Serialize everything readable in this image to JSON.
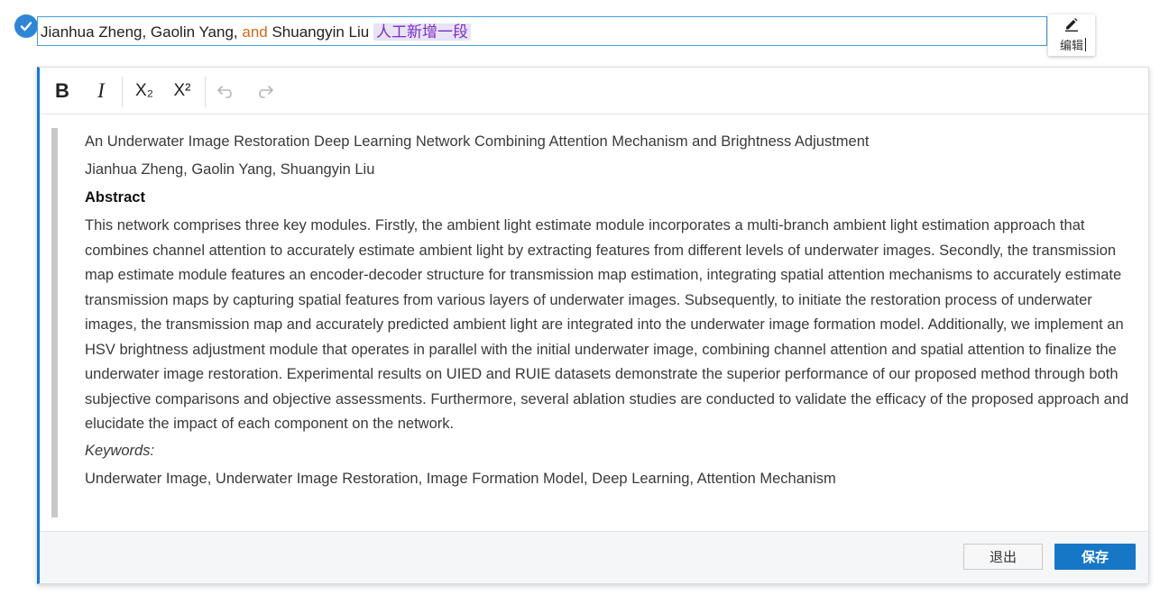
{
  "title_line": {
    "segments": {
      "part1": "Jianhua Zheng, Gaolin Yang, ",
      "and": "and",
      "part2": " Shuangyin Liu ",
      "added": "人工新增一段"
    },
    "check_icon": "check-icon"
  },
  "edit_button": {
    "label": "编辑",
    "icon": "pencil-icon"
  },
  "toolbar": {
    "bold_label": "B",
    "italic_label": "I",
    "subscript_label": "X₂",
    "superscript_label": "X²",
    "undo_icon": "undo-icon",
    "redo_icon": "redo-icon"
  },
  "document": {
    "title": "An Underwater Image Restoration Deep Learning Network Combining Attention Mechanism and Brightness Adjustment",
    "authors": "Jianhua Zheng, Gaolin Yang, Shuangyin Liu",
    "abstract_heading": "Abstract",
    "abstract_text": "This network comprises three key modules. Firstly, the ambient light estimate module incorporates a multi-branch ambient light estimation approach that combines channel attention to accurately estimate ambient light by extracting features from different levels of underwater images. Secondly, the transmission map estimate module features an encoder-decoder structure for transmission map estimation, integrating spatial attention mechanisms to accurately estimate transmission maps by capturing spatial features from various layers of underwater images. Subsequently, to initiate the restoration process of underwater images, the transmission map and accurately predicted ambient light are integrated into the underwater image formation model. Additionally, we implement an HSV brightness adjustment module that operates in parallel with the initial underwater image, combining channel attention and spatial attention to finalize the underwater image restoration. Experimental results on UIED and RUIE datasets demonstrate the superior performance of our proposed method through both subjective comparisons and objective assessments. Furthermore, several ablation studies are conducted to validate the efficacy of the proposed approach and elucidate the impact of each component on the network.",
    "keywords_heading": "Keywords:",
    "keywords": "Underwater Image, Underwater Image Restoration, Image Formation Model, Deep Learning, Attention Mechanism"
  },
  "footer": {
    "exit_label": "退出",
    "save_label": "保存"
  },
  "colors": {
    "accent": "#1677c7",
    "and_text": "#d2691e",
    "added_text": "#7a2fc4",
    "added_bg": "#e9e3f6"
  }
}
